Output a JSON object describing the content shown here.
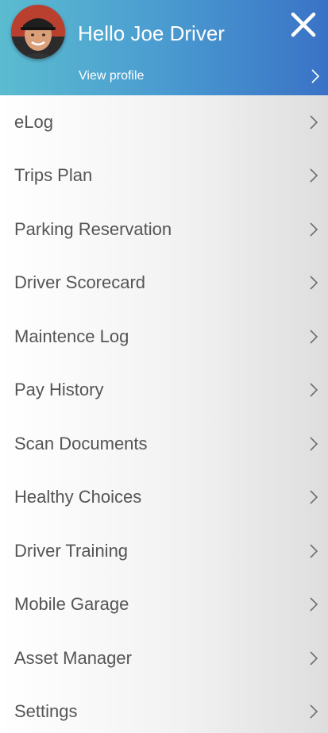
{
  "header": {
    "greeting": "Hello Joe Driver",
    "view_profile_label": "View profile",
    "avatar_icon": "driver-avatar",
    "close_icon": "close-icon",
    "colors": {
      "gradient_start": "#5bbcd0",
      "gradient_end": "#3a72c6"
    }
  },
  "menu": {
    "items": [
      {
        "label": "eLog"
      },
      {
        "label": "Trips Plan"
      },
      {
        "label": "Parking Reservation"
      },
      {
        "label": "Driver Scorecard"
      },
      {
        "label": "Maintence Log"
      },
      {
        "label": "Pay History"
      },
      {
        "label": "Scan Documents"
      },
      {
        "label": "Healthy Choices"
      },
      {
        "label": "Driver Training"
      },
      {
        "label": "Mobile Garage"
      },
      {
        "label": "Asset Manager"
      },
      {
        "label": "Settings"
      }
    ],
    "chevron_icon": "chevron-right-icon",
    "text_color": "#555555"
  }
}
